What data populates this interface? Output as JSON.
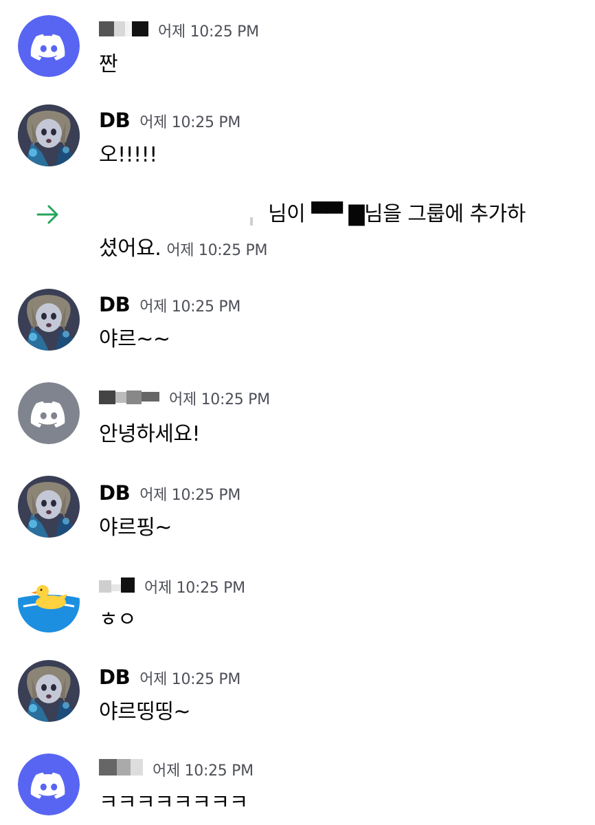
{
  "colors": {
    "discord_blurple": "#5865f2",
    "discord_grey": "#80848e",
    "timestamp": "#4e5058",
    "text": "#060607",
    "join_arrow": "#23a55a"
  },
  "messages": [
    {
      "author": "",
      "avatar": "discord-blue",
      "timestamp": "어제 10:25 PM",
      "text": "짠"
    },
    {
      "author": "DB",
      "avatar": "anime-girl",
      "timestamp": "어제 10:25 PM",
      "text": "오!!!!!"
    },
    {
      "system": true,
      "line1": "님이 ▀▀ ▇님을 그룹에 추가하",
      "line2": "셨어요.",
      "timestamp": "어제 10:25 PM"
    },
    {
      "author": "DB",
      "avatar": "anime-girl",
      "timestamp": "어제 10:25 PM",
      "text": "야르~~"
    },
    {
      "author": "",
      "avatar": "discord-grey",
      "timestamp": "어제 10:25 PM",
      "text": "안녕하세요!"
    },
    {
      "author": "DB",
      "avatar": "anime-girl",
      "timestamp": "어제 10:25 PM",
      "text": "야르핑~"
    },
    {
      "author": "",
      "avatar": "duck",
      "timestamp": "어제 10:25 PM",
      "text": "ㅎㅇ"
    },
    {
      "author": "DB",
      "avatar": "anime-girl",
      "timestamp": "어제 10:25 PM",
      "text": "야르띵띵~"
    },
    {
      "author": "",
      "avatar": "discord-blue",
      "timestamp": "어제 10:25 PM",
      "text": "ㅋㅋㅋㅋㅋㅋㅋㅋ"
    }
  ],
  "icons": {
    "discord_logo": "discord-logo-icon",
    "join_arrow": "arrow-right-icon"
  }
}
